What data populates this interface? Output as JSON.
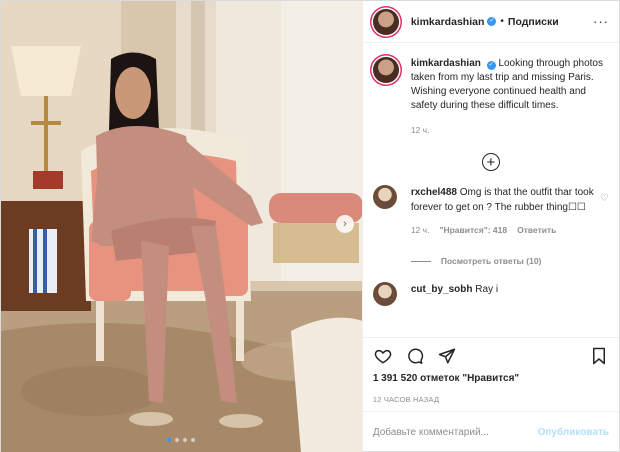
{
  "header": {
    "username": "kimkardashian",
    "separator": "•",
    "follow_label": "Подписки",
    "more_icon": "more-dots-icon"
  },
  "caption": {
    "username": "kimkardashian",
    "text": "Looking through photos taken from my last trip and missing Paris. Wishing everyone continued health and safety during these difficult times.",
    "time": "12 ч."
  },
  "comments": [
    {
      "username": "rxchel488",
      "text": "Omg is that the outfit thar took forever to get on ? The rubber thing☐☐",
      "time": "12 ч.",
      "likes": "\"Нравится\": 418",
      "reply_label": "Ответить",
      "view_replies": "Посмотреть ответы (10)"
    },
    {
      "username": "cut_by_sobh",
      "text": "Ray i"
    }
  ],
  "likes_text": "1 391 520 отметок \"Нравится\"",
  "timestamp": "12 ЧАСОВ НАЗАД",
  "add_comment": {
    "placeholder": "Добавьте комментарий...",
    "publish_label": "Опубликовать"
  },
  "carousel": {
    "dot_count": 4,
    "active_index": 0
  },
  "colors": {
    "accent": "#3897f0",
    "publish_disabled": "#b2dffc",
    "muted": "#8e8e8e"
  }
}
